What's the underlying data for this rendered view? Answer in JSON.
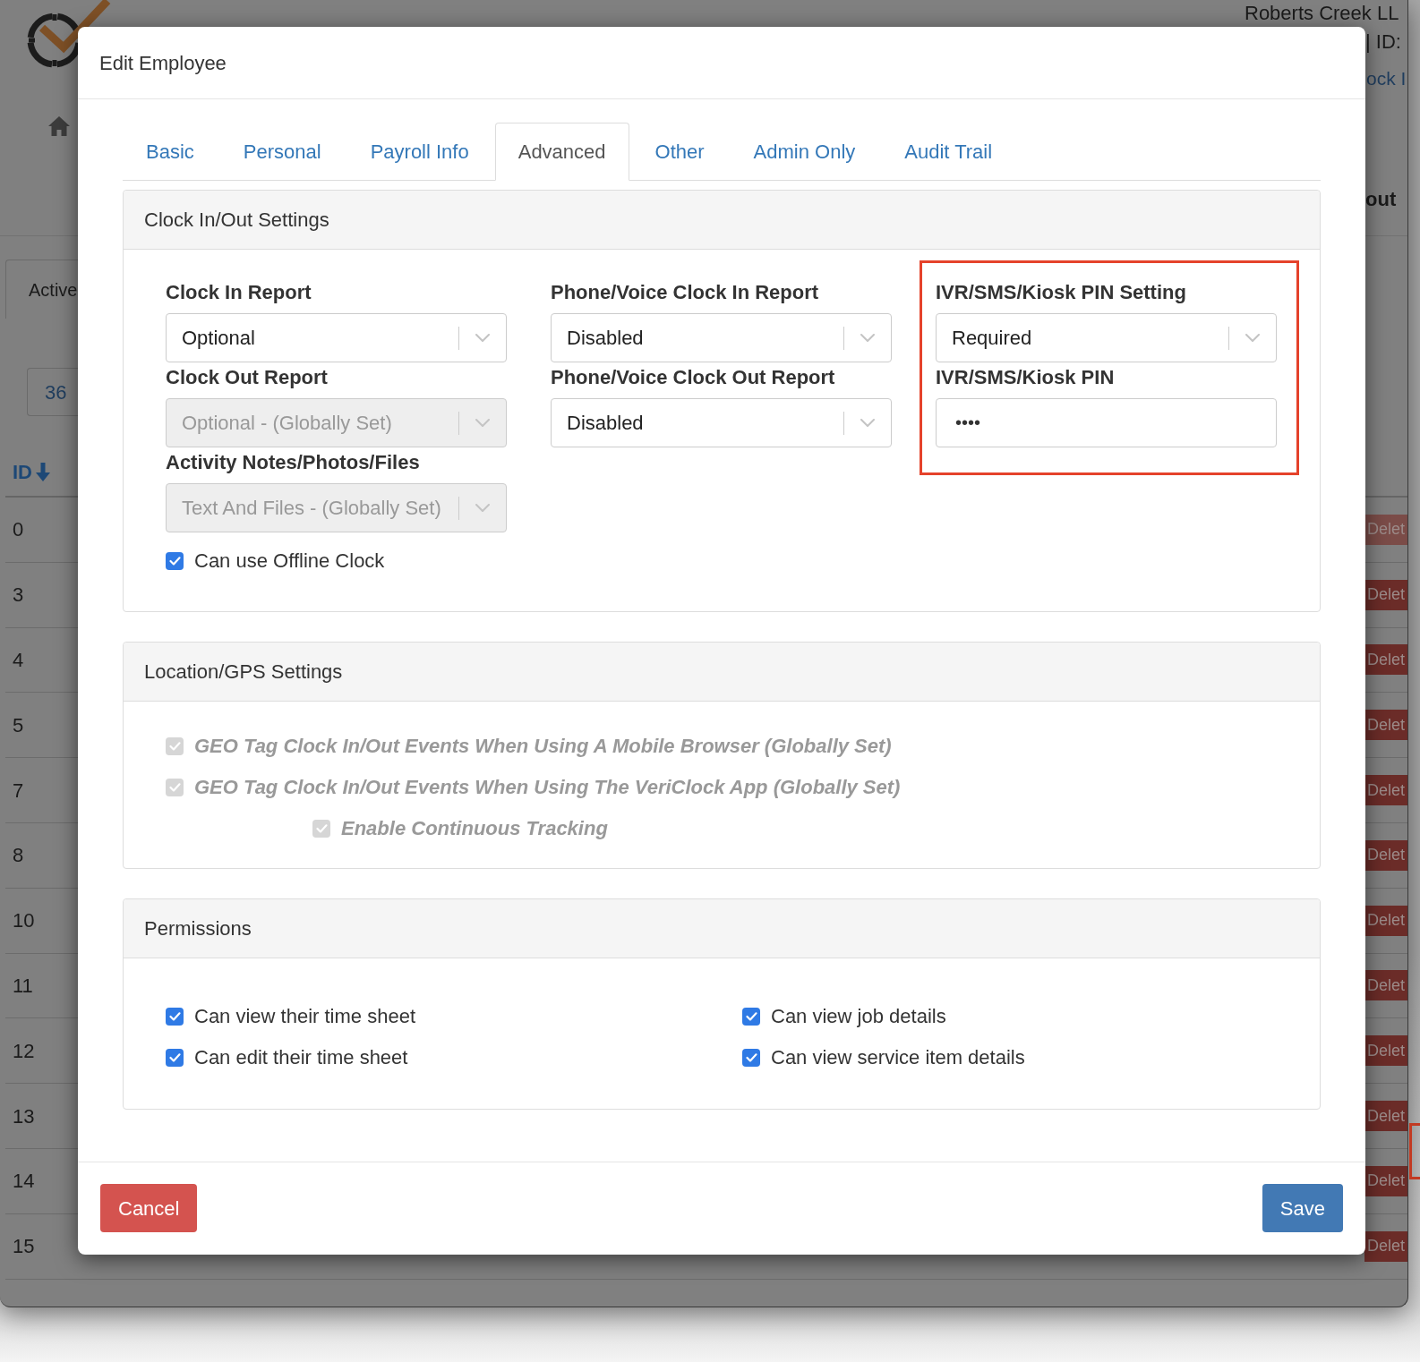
{
  "background": {
    "header": {
      "company": "Roberts Creek LL",
      "account_id": "| ID:",
      "link": "ock I",
      "column_heading": "out"
    },
    "tab": {
      "label": "Active",
      "selected": true
    },
    "count": "36",
    "table": {
      "id_heading": "ID",
      "rows": [
        {
          "id": "0",
          "action": "Delet",
          "disabled": true
        },
        {
          "id": "3",
          "action": "Delet",
          "disabled": false
        },
        {
          "id": "4",
          "action": "Delet",
          "disabled": false
        },
        {
          "id": "5",
          "action": "Delet",
          "disabled": false
        },
        {
          "id": "7",
          "action": "Delet",
          "disabled": false
        },
        {
          "id": "8",
          "action": "Delet",
          "disabled": false
        },
        {
          "id": "10",
          "action": "Delet",
          "disabled": false
        },
        {
          "id": "11",
          "action": "Delet",
          "disabled": false
        },
        {
          "id": "12",
          "action": "Delet",
          "disabled": false
        },
        {
          "id": "13",
          "action": "Delet",
          "disabled": false
        },
        {
          "id": "14",
          "action": "Delet",
          "disabled": false
        },
        {
          "id": "15",
          "action": "Delet",
          "disabled": false
        }
      ]
    }
  },
  "modal": {
    "title": "Edit Employee",
    "tabs": [
      {
        "label": "Basic",
        "selected": false
      },
      {
        "label": "Personal",
        "selected": false
      },
      {
        "label": "Payroll Info",
        "selected": false
      },
      {
        "label": "Advanced",
        "selected": true
      },
      {
        "label": "Other",
        "selected": false
      },
      {
        "label": "Admin Only",
        "selected": false
      },
      {
        "label": "Audit Trail",
        "selected": false
      }
    ],
    "panels": [
      {
        "title": "Clock In/Out Settings",
        "kind": "form",
        "columns": [
          {
            "highlighted": false,
            "items": [
              {
                "kind": "select",
                "label": "Clock In Report",
                "value": "Optional",
                "disabled": false
              },
              {
                "kind": "select",
                "label": "Clock Out Report",
                "value": "Optional - (Globally Set)",
                "disabled": true
              },
              {
                "kind": "select",
                "label": "Activity Notes/Photos/Files",
                "value": "Text And Files - (Globally Set)",
                "disabled": true
              },
              {
                "kind": "checkbox",
                "label": "Can use Offline Clock",
                "checked": true,
                "disabled": false
              }
            ]
          },
          {
            "highlighted": false,
            "items": [
              {
                "kind": "select",
                "label": "Phone/Voice Clock In Report",
                "value": "Disabled",
                "disabled": false
              },
              {
                "kind": "select",
                "label": "Phone/Voice Clock Out Report",
                "value": "Disabled",
                "disabled": false
              }
            ]
          },
          {
            "highlighted": true,
            "items": [
              {
                "kind": "select",
                "label": "IVR/SMS/Kiosk PIN Setting",
                "value": "Required",
                "disabled": false
              },
              {
                "kind": "password",
                "label": "IVR/SMS/Kiosk PIN",
                "value": "••••"
              }
            ]
          }
        ]
      },
      {
        "title": "Location/GPS Settings",
        "kind": "checklist",
        "columns": [
          {
            "items": [
              {
                "kind": "checkbox",
                "label": "GEO Tag Clock In/Out Events When Using A Mobile Browser (Globally Set)",
                "checked": true,
                "disabled": true
              },
              {
                "kind": "checkbox",
                "label": "GEO Tag Clock In/Out Events When Using The VeriClock App (Globally Set)",
                "checked": true,
                "disabled": true,
                "children": [
                  {
                    "kind": "checkbox",
                    "label": "Enable Continuous Tracking",
                    "checked": true,
                    "disabled": true
                  }
                ]
              }
            ]
          }
        ]
      },
      {
        "title": "Permissions",
        "kind": "checklist",
        "columns": [
          {
            "items": [
              {
                "kind": "checkbox",
                "label": "Can view their time sheet",
                "checked": true,
                "disabled": false
              },
              {
                "kind": "checkbox",
                "label": "Can edit their time sheet",
                "checked": true,
                "disabled": false
              }
            ]
          },
          {
            "items": [
              {
                "kind": "checkbox",
                "label": "Can view job details",
                "checked": true,
                "disabled": false
              },
              {
                "kind": "checkbox",
                "label": "Can view service item details",
                "checked": true,
                "disabled": false
              }
            ]
          }
        ]
      }
    ],
    "buttons": [
      {
        "label": "Cancel",
        "kind": "danger"
      },
      {
        "label": "Save",
        "kind": "primary"
      }
    ]
  }
}
